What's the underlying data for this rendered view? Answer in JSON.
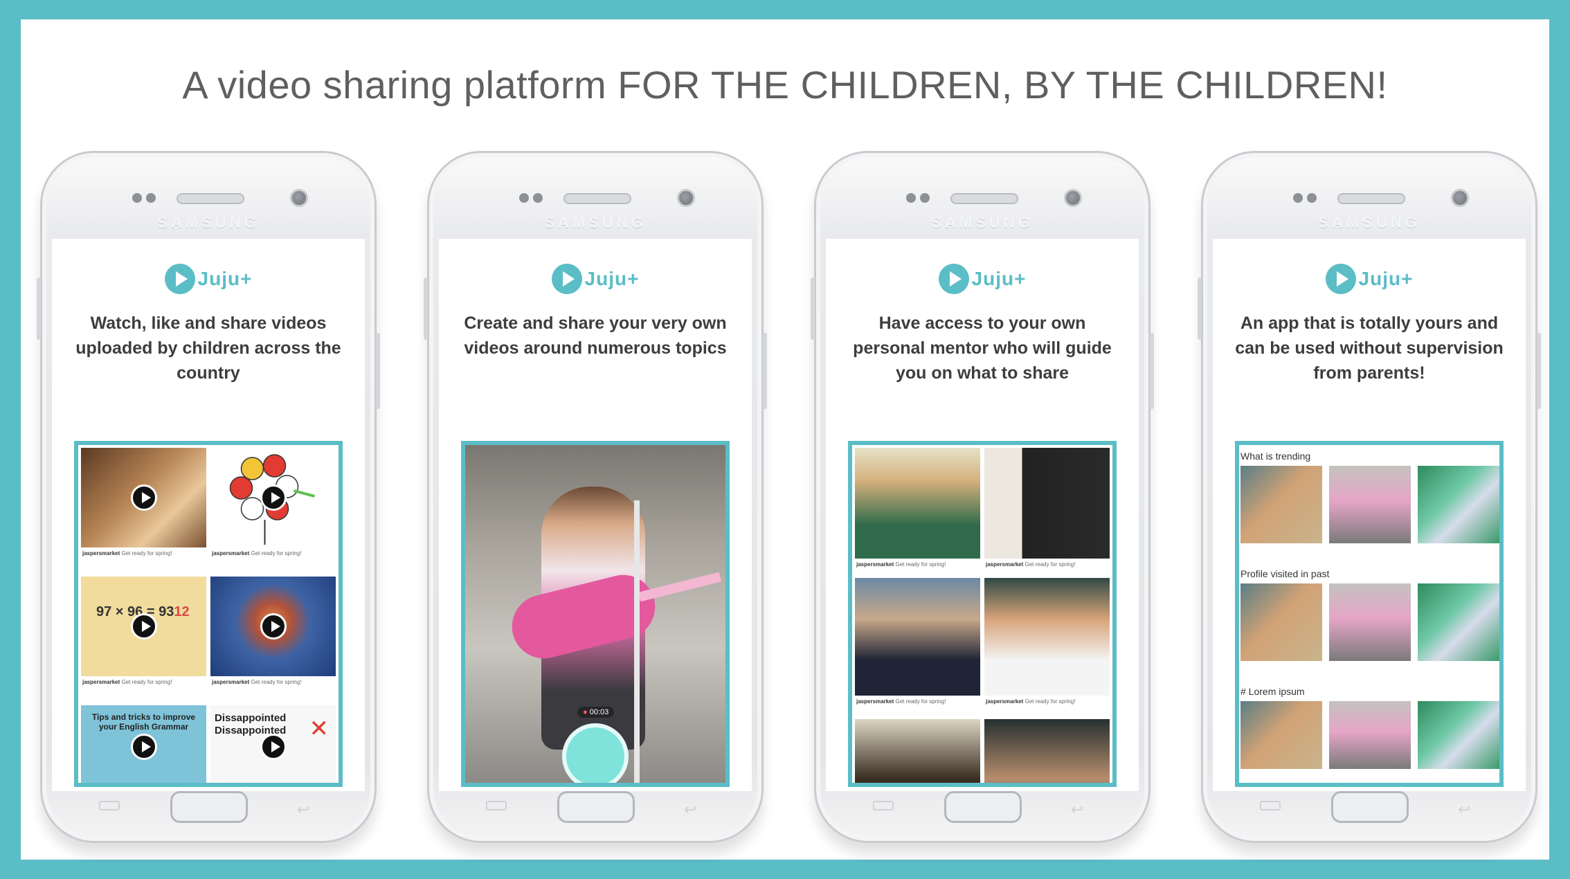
{
  "headline": "A video sharing platform FOR THE CHILDREN, BY THE CHILDREN!",
  "colors": {
    "background": "#5bbdc6",
    "accent": "#5bbdc6",
    "panel": "#ffffff"
  },
  "brand_label": "SAMSUNG",
  "app_name": "Juju+",
  "phones": [
    {
      "caption": "Watch, like and share videos uploaded by children across the country",
      "tiles": [
        {
          "user": "jaspersmarket",
          "text": "Get ready for spring!"
        },
        {
          "user": "jaspersmarket",
          "text": "Get ready for spring!"
        },
        {
          "user": "jaspersmarket",
          "text": "Get ready for spring!",
          "math": "97 × 96 = 9312",
          "math_red": "12"
        },
        {
          "user": "jaspersmarket",
          "text": "Get ready for spring!"
        },
        {
          "title": "Tips and tricks to improve your English Grammar"
        },
        {
          "title": "Dissappointed Dissappointed"
        }
      ]
    },
    {
      "caption": "Create and share your very own videos around numerous topics",
      "timer": "00:03"
    },
    {
      "caption": "Have access to your own personal mentor who will guide you on what to share",
      "tiles": [
        {
          "user": "jaspersmarket",
          "text": "Get ready for spring!"
        },
        {
          "user": "jaspersmarket",
          "text": "Get ready for spring!"
        },
        {
          "user": "jaspersmarket",
          "text": "Get ready for spring!"
        },
        {
          "user": "jaspersmarket",
          "text": "Get ready for spring!"
        }
      ]
    },
    {
      "caption": "An app that is totally yours and can be used without supervision from parents!",
      "sections": [
        "What is trending",
        "Profile visited in past",
        "# Lorem ipsum"
      ]
    }
  ]
}
